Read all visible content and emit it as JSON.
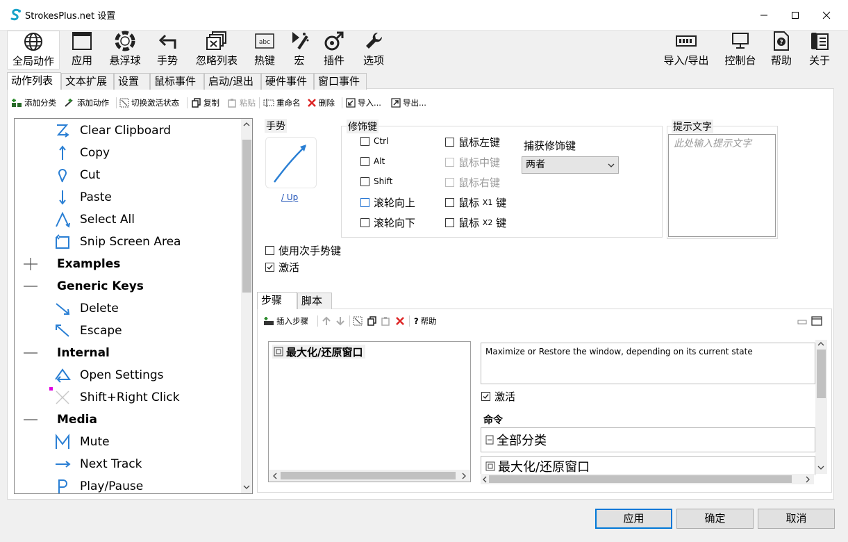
{
  "window": {
    "title": "StrokesPlus.net 设置",
    "controls": [
      "minimize",
      "maximize",
      "close"
    ]
  },
  "toolbar": {
    "left": [
      {
        "label": "全局动作",
        "icon": "globe-icon",
        "selected": true
      },
      {
        "label": "应用",
        "icon": "window-icon"
      },
      {
        "label": "悬浮球",
        "icon": "lifebuoy-icon"
      },
      {
        "label": "手势",
        "icon": "arrow-turn-icon"
      },
      {
        "label": "忽略列表",
        "icon": "ignore-list-icon"
      },
      {
        "label": "热键",
        "icon": "keyboard-key-icon"
      },
      {
        "label": "宏",
        "icon": "macro-icon"
      },
      {
        "label": "插件",
        "icon": "plugin-icon"
      },
      {
        "label": "选项",
        "icon": "wrench-icon"
      }
    ],
    "right": [
      {
        "label": "导入/导出",
        "icon": "import-export-icon"
      },
      {
        "label": "控制台",
        "icon": "console-icon"
      },
      {
        "label": "帮助",
        "icon": "help-icon"
      },
      {
        "label": "关于",
        "icon": "about-icon"
      }
    ]
  },
  "tabs": [
    "动作列表",
    "文本扩展",
    "设置",
    "鼠标事件",
    "启动/退出",
    "硬件事件",
    "窗口事件"
  ],
  "action_toolbar": {
    "add_category": "添加分类",
    "add_action": "添加动作",
    "toggle_active": "切换激活状态",
    "copy": "复制",
    "paste": "粘贴",
    "rename": "重命名",
    "delete": "删除",
    "import": "导入...",
    "export": "导出..."
  },
  "tree": [
    {
      "label": "Clear Clipboard",
      "type": "action",
      "icon": "z-gesture-icon"
    },
    {
      "label": "Copy",
      "type": "action",
      "icon": "arrow-up-icon"
    },
    {
      "label": "Cut",
      "type": "action",
      "icon": "loop-gesture-icon"
    },
    {
      "label": "Paste",
      "type": "action",
      "icon": "arrow-down-icon"
    },
    {
      "label": "Select All",
      "type": "action",
      "icon": "caret-gesture-icon"
    },
    {
      "label": "Snip Screen Area",
      "type": "action",
      "icon": "snip-gesture-icon"
    },
    {
      "label": "Examples",
      "type": "category",
      "expanded": false
    },
    {
      "label": "Generic Keys",
      "type": "category",
      "expanded": true
    },
    {
      "label": "Delete",
      "type": "action",
      "icon": "arrow-down-right-icon"
    },
    {
      "label": "Escape",
      "type": "action",
      "icon": "arrow-up-left-icon"
    },
    {
      "label": "Internal",
      "type": "category",
      "expanded": true
    },
    {
      "label": "Open Settings",
      "type": "action",
      "icon": "triangle-gesture-icon"
    },
    {
      "label": "Shift+Right Click",
      "type": "action",
      "icon": "cross-gesture-icon"
    },
    {
      "label": "Media",
      "type": "category",
      "expanded": true
    },
    {
      "label": "Mute",
      "type": "action",
      "icon": "m-gesture-icon"
    },
    {
      "label": "Next Track",
      "type": "action",
      "icon": "arrow-right-icon"
    },
    {
      "label": "Play/Pause",
      "type": "action",
      "icon": "p-gesture-icon"
    }
  ],
  "gesture": {
    "group_label": "手势",
    "link": "/ Up"
  },
  "modifiers": {
    "group_label": "修饰键",
    "ctrl": "Ctrl",
    "alt": "Alt",
    "shift": "Shift",
    "wheel_up": "滚轮向上",
    "wheel_down": "滚轮向下",
    "mouse_left": "鼠标左键",
    "mouse_middle": "鼠标中键",
    "mouse_right": "鼠标右键",
    "mouse_x1": "鼠标",
    "mouse_x1_small": "X1",
    "mouse_x2": "鼠标",
    "mouse_x2_small": "X2",
    "key_suffix": "键",
    "capture_label": "捕获修饰键",
    "capture_value": "两者"
  },
  "hint": {
    "group_label": "提示文字",
    "placeholder": "此处输入提示文字"
  },
  "options": {
    "use_secondary": "使用次手势键",
    "active": "激活",
    "active_checked": true
  },
  "steps": {
    "tabs": [
      "步骤",
      "脚本"
    ],
    "insert_step": "插入步骤",
    "help": "帮助",
    "items": [
      "最大化/还原窗口"
    ],
    "description": "Maximize or Restore the window, depending on its current state",
    "active": "激活",
    "command_label": "命令",
    "command_category": "全部分类",
    "command_value": "最大化/还原窗口"
  },
  "buttons": {
    "apply": "应用",
    "ok": "确定",
    "cancel": "取消"
  }
}
